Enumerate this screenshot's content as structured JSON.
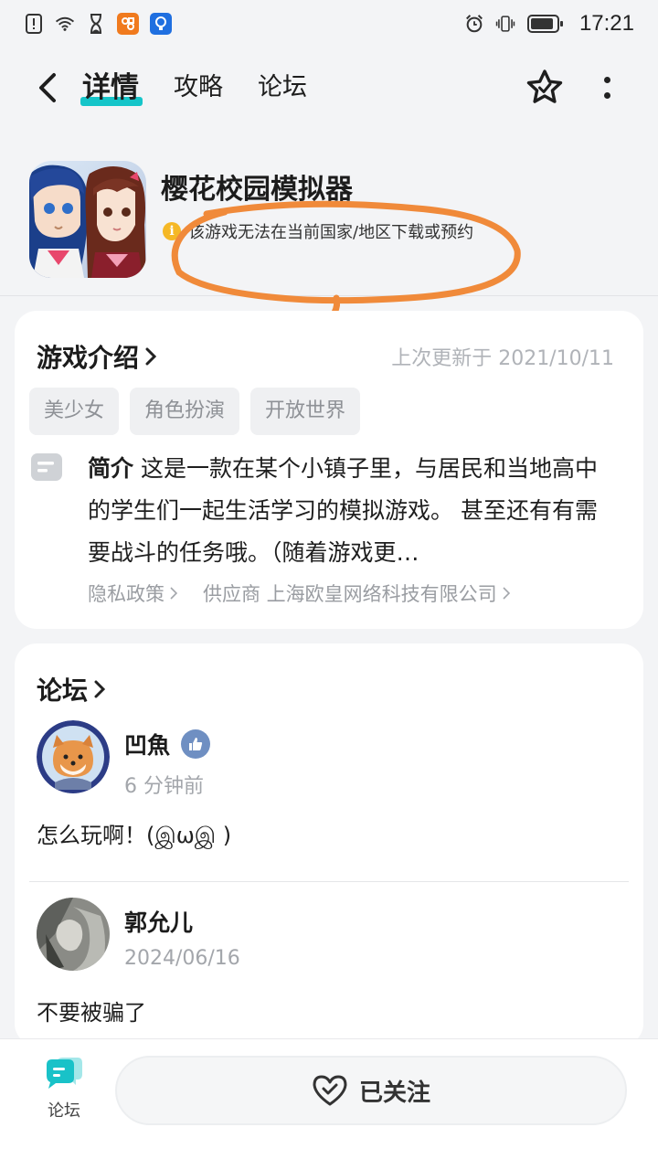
{
  "status_bar": {
    "time": "17:21",
    "left_icons": [
      "alert-icon",
      "wifi-icon",
      "hourglass-icon",
      "app-icon-orange",
      "app-icon-blue"
    ],
    "right_icons": [
      "alarm-icon",
      "vibrate-icon",
      "battery-icon"
    ]
  },
  "nav": {
    "tabs": [
      {
        "label": "详情",
        "active": true
      },
      {
        "label": "攻略",
        "active": false
      },
      {
        "label": "论坛",
        "active": false
      }
    ],
    "accent_color": "#15c5c9"
  },
  "game": {
    "title": "樱花校园模拟器",
    "notice": "该游戏无法在当前国家/地区下载或预约"
  },
  "intro": {
    "title": "游戏介绍",
    "updated": "上次更新于 2021/10/11",
    "tags": [
      "美少女",
      "角色扮演",
      "开放世界"
    ],
    "summary_label": "简介",
    "summary": "这是一款在某个小镇子里，与居民和当地高中的学生们一起生活学习的模拟游戏。 甚至还有有需要战斗的任务哦。（随着游戏更…",
    "privacy": "隐私政策",
    "supplier": "供应商 上海欧皇网络科技有限公司"
  },
  "forum": {
    "title": "论坛",
    "posts": [
      {
        "user": "凹魚",
        "time": "6 分钟前",
        "content": "怎么玩啊！(இωஇ )",
        "verified": true
      },
      {
        "user": "郭允儿",
        "time": "2024/06/16",
        "content": "不要被骗了",
        "verified": false
      }
    ]
  },
  "bottom": {
    "forum_label": "论坛",
    "follow_label": "已关注"
  }
}
